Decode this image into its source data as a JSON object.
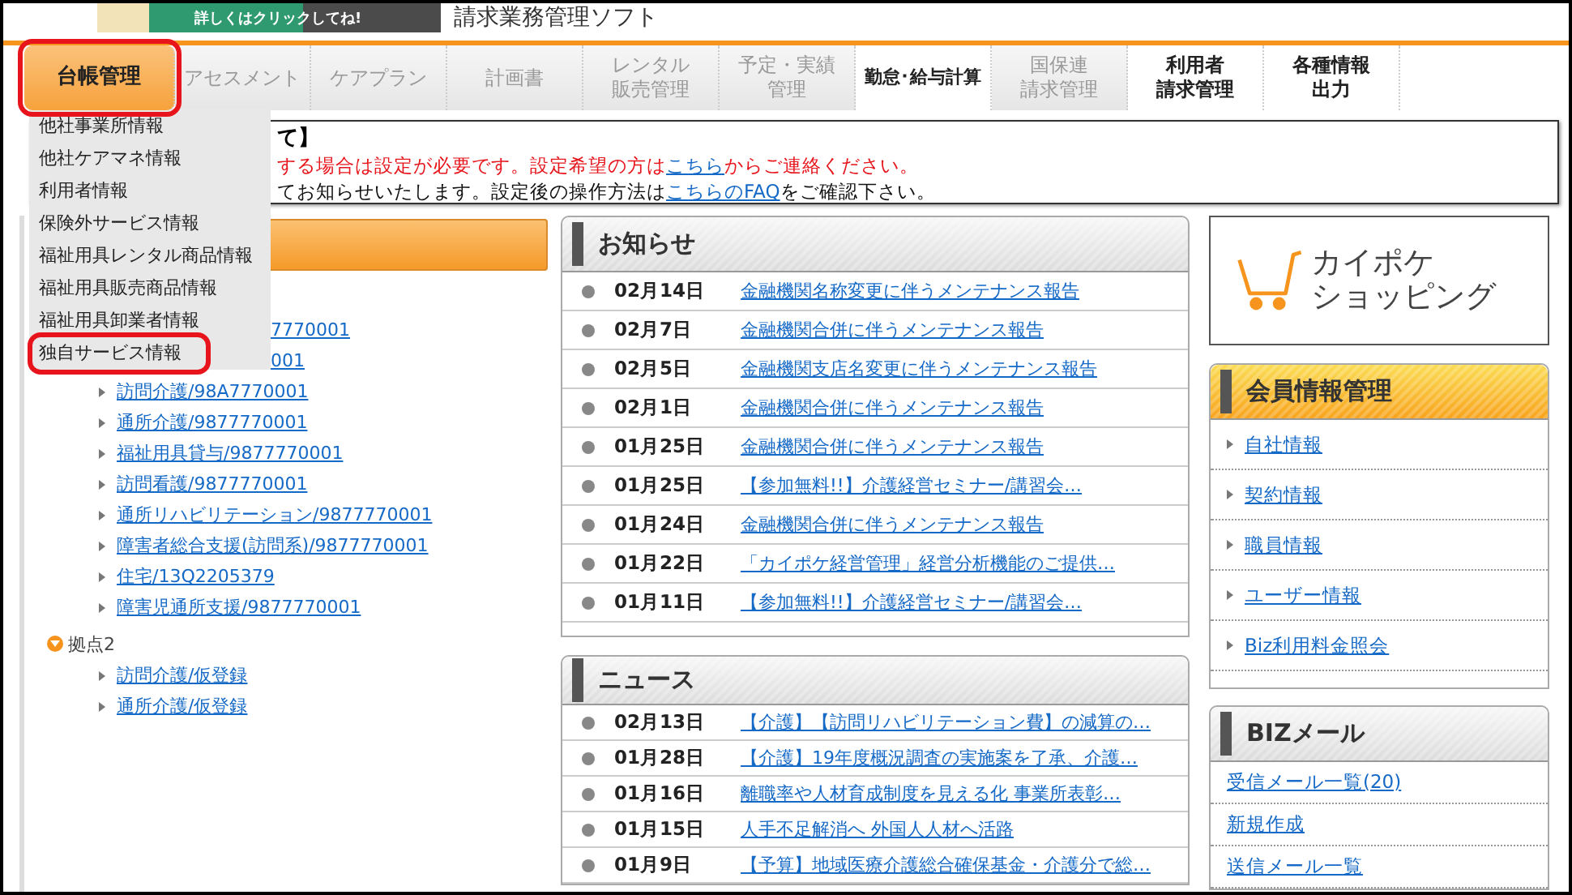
{
  "header": {
    "banner_text": "詳しくはクリックしてね!",
    "title": "請求業務管理ソフト"
  },
  "nav_tabs": [
    {
      "lines": [
        "台帳管理"
      ],
      "selected": true,
      "disabled": false,
      "highlighted": true
    },
    {
      "lines": [
        "アセスメント"
      ],
      "selected": false,
      "disabled": true,
      "highlighted": false
    },
    {
      "lines": [
        "ケアプラン"
      ],
      "selected": false,
      "disabled": true,
      "highlighted": false
    },
    {
      "lines": [
        "計画書"
      ],
      "selected": false,
      "disabled": true,
      "highlighted": false
    },
    {
      "lines": [
        "レンタル",
        "販売管理"
      ],
      "selected": false,
      "disabled": true,
      "highlighted": false
    },
    {
      "lines": [
        "予定・実績",
        "管理"
      ],
      "selected": false,
      "disabled": true,
      "highlighted": false
    },
    {
      "lines": [
        "勤怠･給与計算"
      ],
      "selected": false,
      "disabled": false,
      "highlighted": false
    },
    {
      "lines": [
        "国保連",
        "請求管理"
      ],
      "selected": false,
      "disabled": true,
      "highlighted": false
    },
    {
      "lines": [
        "利用者",
        "請求管理"
      ],
      "selected": false,
      "disabled": false,
      "highlighted": false
    },
    {
      "lines": [
        "各種情報",
        "出力"
      ],
      "selected": false,
      "disabled": false,
      "highlighted": false
    }
  ],
  "dropdown_menu": [
    {
      "label": "他社事業所情報",
      "highlighted": false
    },
    {
      "label": "他社ケアマネ情報",
      "highlighted": false
    },
    {
      "label": "利用者情報",
      "highlighted": false
    },
    {
      "label": "保険外サービス情報",
      "highlighted": false
    },
    {
      "label": "福祉用具レンタル商品情報",
      "highlighted": false
    },
    {
      "label": "福祉用具販売商品情報",
      "highlighted": false
    },
    {
      "label": "福祉用具卸業者情報",
      "highlighted": false
    },
    {
      "label": "独自サービス情報",
      "highlighted": true
    }
  ],
  "notice": {
    "title": "て】",
    "lines": [
      {
        "kind": "warning",
        "parts": [
          {
            "text": "する場合は設定が必要です。設定希望の方は",
            "link": false
          },
          {
            "text": "こちら",
            "link": true
          },
          {
            "text": "からご連絡ください。",
            "link": false
          }
        ]
      },
      {
        "kind": "info",
        "parts": [
          {
            "text": "てお知らせいたします。設定後の操作方法は",
            "link": false
          },
          {
            "text": "こちらのFAQ",
            "link": true
          },
          {
            "text": "をご確認下さい。",
            "link": false
          }
        ]
      }
    ]
  },
  "tree": [
    {
      "children": [
        {
          "label": "7770001",
          "kind": "clipped"
        },
        {
          "label": "001",
          "kind": "clipped"
        },
        {
          "label": "訪問介護/98A7770001",
          "kind": "full"
        },
        {
          "label": "通所介護/9877770001",
          "kind": "full"
        },
        {
          "label": "福祉用具貸与/9877770001",
          "kind": "full"
        },
        {
          "label": "訪問看護/9877770001",
          "kind": "full"
        },
        {
          "label": "通所リハビリテーション/9877770001",
          "kind": "full"
        },
        {
          "label": "障害者総合支援(訪問系)/9877770001",
          "kind": "full"
        },
        {
          "label": "住宅/13Q2205379",
          "kind": "full"
        },
        {
          "label": "障害児通所支援/9877770001",
          "kind": "full"
        }
      ]
    },
    {
      "label": "拠点2",
      "children": [
        {
          "label": "訪問介護/仮登録",
          "kind": "full"
        },
        {
          "label": "通所介護/仮登録",
          "kind": "full"
        }
      ]
    }
  ],
  "notices": {
    "title": "お知らせ",
    "items": [
      {
        "date": "02月14日",
        "title": "金融機関名称変更に伴うメンテナンス報告"
      },
      {
        "date": "02月7日",
        "title": "金融機関合併に伴うメンテナンス報告"
      },
      {
        "date": "02月5日",
        "title": "金融機関支店名変更に伴うメンテナンス報告"
      },
      {
        "date": "02月1日",
        "title": "金融機関合併に伴うメンテナンス報告"
      },
      {
        "date": "01月25日",
        "title": "金融機関合併に伴うメンテナンス報告"
      },
      {
        "date": "01月25日",
        "title": "【参加無料!!】介護経営セミナー/講習会…"
      },
      {
        "date": "01月24日",
        "title": "金融機関合併に伴うメンテナンス報告"
      },
      {
        "date": "01月22日",
        "title": "「カイポケ経営管理」経営分析機能のご提供…"
      },
      {
        "date": "01月11日",
        "title": "【参加無料!!】介護経営セミナー/講習会…"
      }
    ]
  },
  "news": {
    "title": "ニュース",
    "items": [
      {
        "date": "02月13日",
        "title": "【介護】【訪問リハビリテーション費】の減算の…"
      },
      {
        "date": "01月28日",
        "title": "【介護】19年度概況調査の実施案を了承、介護…"
      },
      {
        "date": "01月16日",
        "title": "離職率や人材育成制度を見える化 事業所表彰…"
      },
      {
        "date": "01月15日",
        "title": "人手不足解消へ 外国人人材へ活路"
      },
      {
        "date": "01月9日",
        "title": "【予算】地域医療介護総合確保基金・介護分で総…"
      }
    ]
  },
  "shop_banner": {
    "lines": [
      "カイポケ",
      "ショッピング"
    ]
  },
  "member_panel": {
    "title": "会員情報管理",
    "links": [
      "自社情報",
      "契約情報",
      "職員情報",
      "ユーザー情報",
      "Biz利用料金照会"
    ]
  },
  "mail_panel": {
    "title": "BIZメール",
    "links": [
      "受信メール一覧(20)",
      "新規作成",
      "送信メール一覧"
    ]
  }
}
